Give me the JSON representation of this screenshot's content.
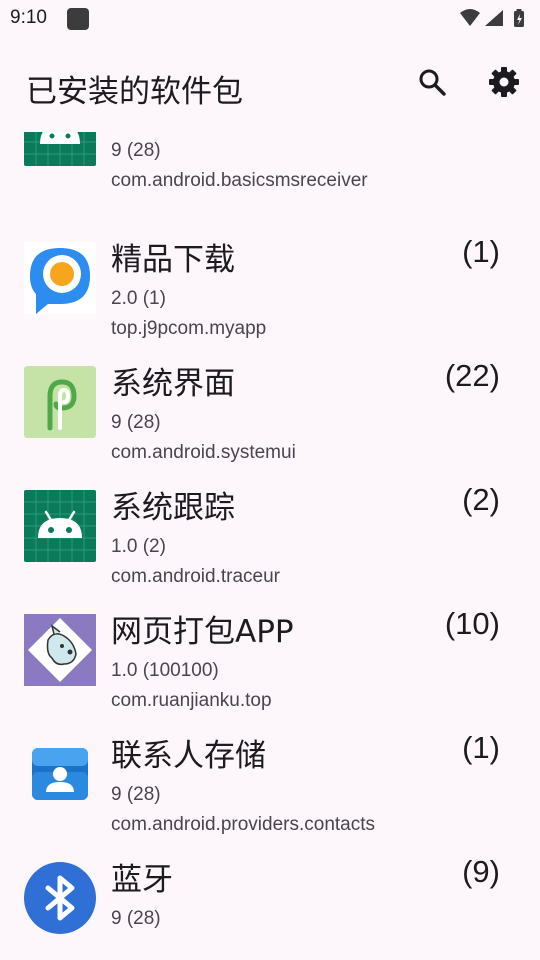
{
  "status": {
    "time": "9:10",
    "icons": [
      "notification-square-icon",
      "wifi-icon",
      "signal-icon",
      "battery-icon"
    ]
  },
  "appbar": {
    "title": "已安装的软件包",
    "actions": [
      "search-icon",
      "settings-gear-icon"
    ]
  },
  "packages": [
    {
      "name": "",
      "count": "",
      "version": "9 (28)",
      "package": "com.android.basicsmsreceiver",
      "icon": "android-robot-icon"
    },
    {
      "name": "精品下载",
      "count": "(1)",
      "version": "2.0 (1)",
      "package": "top.j9pcom.myapp",
      "icon": "p-download-logo-icon"
    },
    {
      "name": "系统界面",
      "count": "(22)",
      "version": "9 (28)",
      "package": "com.android.systemui",
      "icon": "android-p-logo-icon"
    },
    {
      "name": "系统跟踪",
      "count": "(2)",
      "version": "1.0 (2)",
      "package": "com.android.traceur",
      "icon": "android-robot-icon"
    },
    {
      "name": "网页打包APP",
      "count": "(10)",
      "version": "1.0 (100100)",
      "package": "com.ruanjianku.top",
      "icon": "cartoon-dog-icon"
    },
    {
      "name": "联系人存储",
      "count": "(1)",
      "version": "9 (28)",
      "package": "com.android.providers.contacts",
      "icon": "contacts-card-icon"
    },
    {
      "name": "蓝牙",
      "count": "(9)",
      "version": "9 (28)",
      "package": "",
      "icon": "bluetooth-icon"
    }
  ]
}
